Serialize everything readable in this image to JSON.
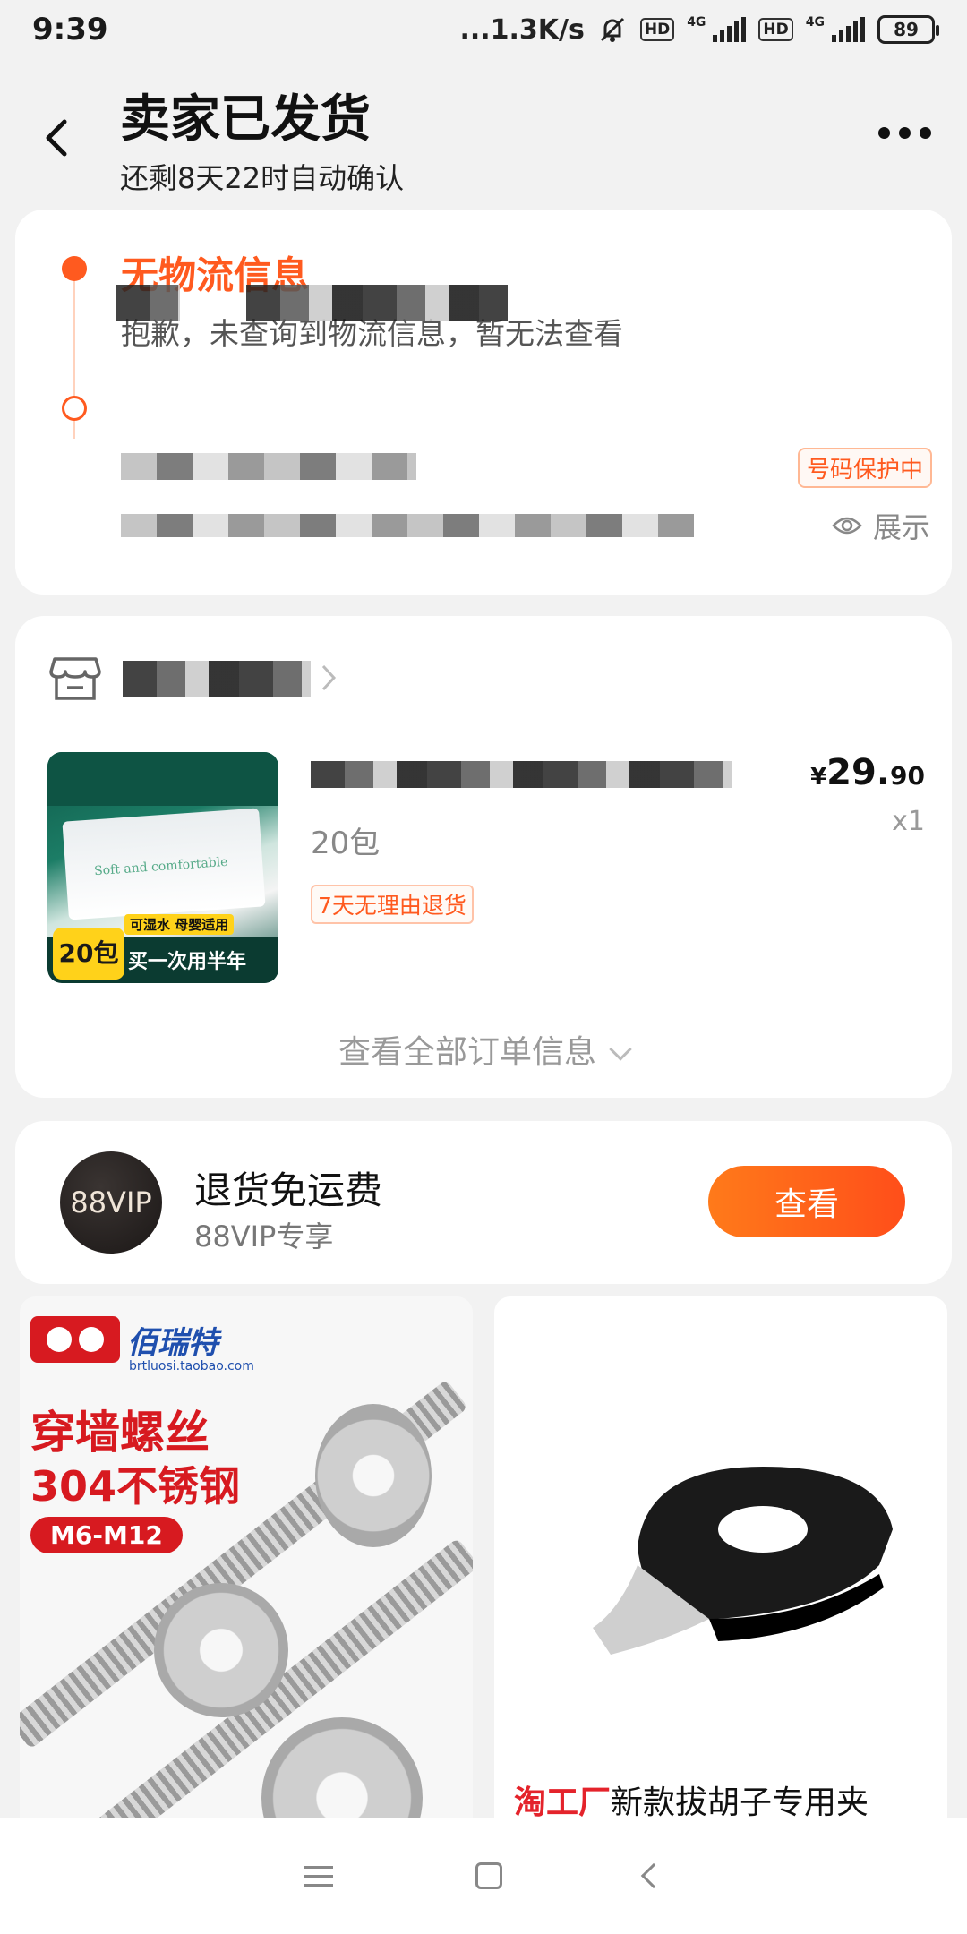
{
  "status_bar": {
    "time": "9:39",
    "net_speed": "...1.3K/s",
    "hd1": "HD",
    "net1": "4G",
    "hd2": "HD",
    "net2": "4G",
    "battery": "89"
  },
  "header": {
    "title": "卖家已发货",
    "subtitle": "还剩8天22时自动确认"
  },
  "logistics": {
    "title": "无物流信息",
    "description": "抱歉，未查询到物流信息，暂无法查看",
    "protect_badge": "号码保护中",
    "show_label": "展示"
  },
  "order": {
    "thumb": {
      "soft_text": "Soft and comfortable",
      "pack_size": "20包",
      "tag": "可湿水 母婴适用",
      "banner": "买一次用半年"
    },
    "spec": "20包",
    "return_badge": "7天无理由退货",
    "price_currency": "¥",
    "price_int": "29.",
    "price_dec": "90",
    "quantity": "x1",
    "view_all": "查看全部订单信息"
  },
  "vip": {
    "logo": "88VIP",
    "title": "退货免运费",
    "subtitle": "88VIP专享",
    "button": "查看"
  },
  "recommendations": [
    {
      "brand": "佰瑞特",
      "url": "brtluosi.taobao.com",
      "headline1": "穿墙螺丝",
      "headline2": "304不锈钢",
      "tag": "M6-M12"
    },
    {
      "brand_label": "淘工厂",
      "title": "新款拔胡子专用夹"
    }
  ],
  "colors": {
    "accent": "#ff5a1f",
    "background": "#f2f2f2",
    "card": "#ffffff"
  }
}
